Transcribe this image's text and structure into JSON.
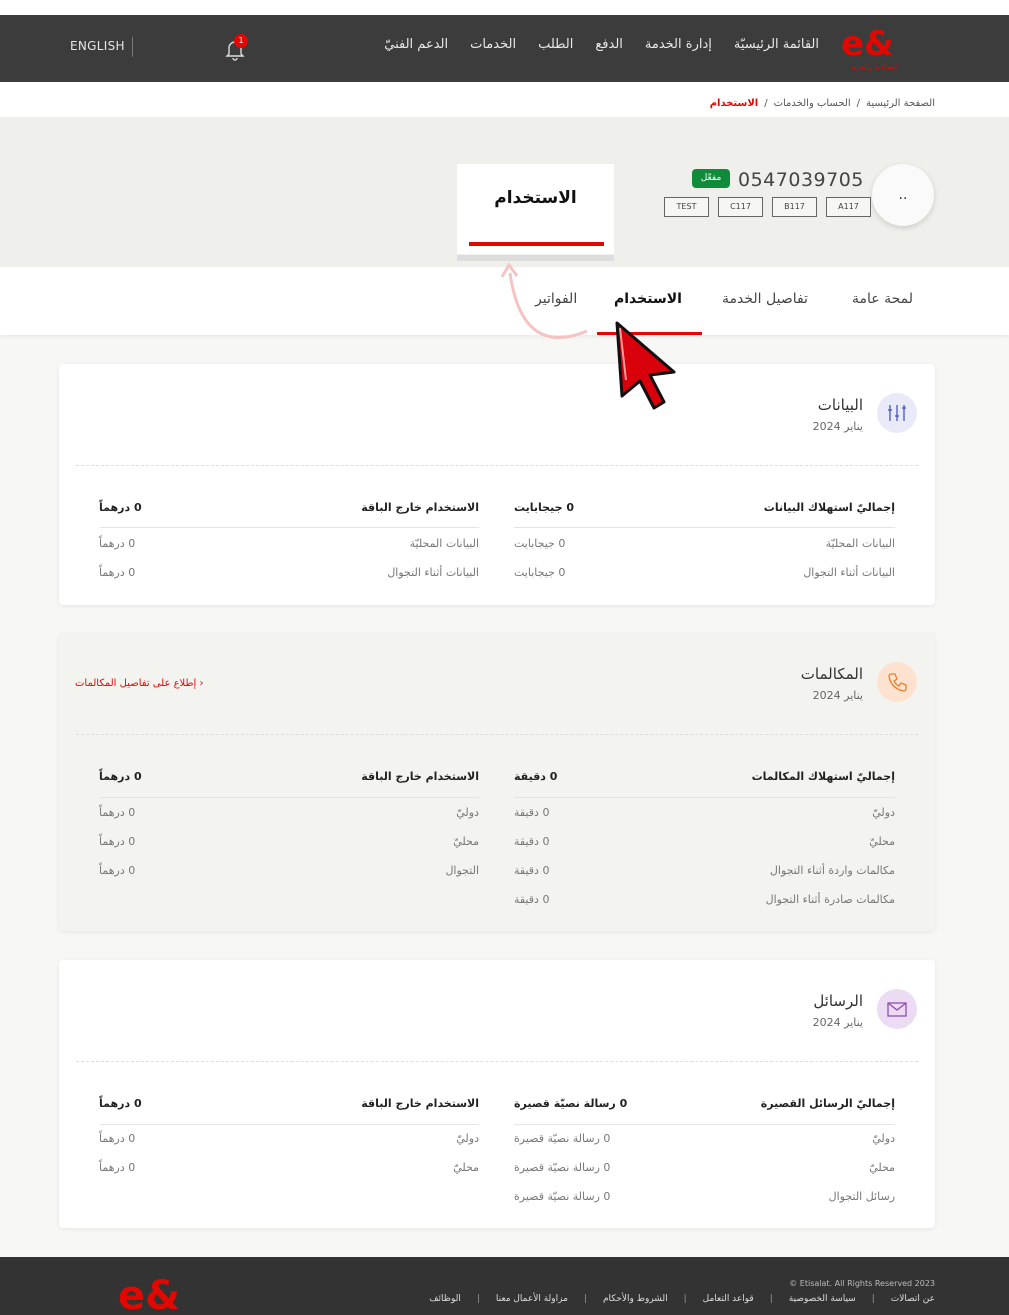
{
  "nav": {
    "language": "ENGLISH",
    "notification_count": "1",
    "menu": [
      "القائمة الرئيسيّة",
      "إدارة الخدمة",
      "الدفع",
      "الطلب",
      "الخدمات",
      "الدعم الفنيّ"
    ],
    "logo_sub": "اتصالات والمزيد"
  },
  "breadcrumb": {
    "home": "الصفحة الرئيسية",
    "section": "الحساب والخدمات",
    "current": "الاستخدام",
    "sep": "/"
  },
  "account": {
    "avatar": "..",
    "number": "0547039705",
    "status": "مفعّل",
    "chips": [
      "A117",
      "B117",
      "C117",
      "TEST"
    ],
    "zoom_title": "الاستخدام"
  },
  "tabs": [
    "لمحة عامة",
    "تفاصيل الخدمة",
    "الاستخدام",
    "الفواتير"
  ],
  "data_card": {
    "title": "البيانات",
    "period": "يناير 2024",
    "left_header": "إجماليّ استهلاك البيانات",
    "left_total": "0 جيجابايت",
    "right_header": "الاستخدام خارج الباقة",
    "right_total": "0 درهماً",
    "left_rows": [
      {
        "label": "البيانات المحليّة",
        "value": "0 جيجابايت"
      },
      {
        "label": "البيانات أثناء التجوال",
        "value": "0 جيجابايت"
      }
    ],
    "right_rows": [
      {
        "label": "البيانات المحليّة",
        "value": "0 درهماً"
      },
      {
        "label": "البيانات أثناء التجوال",
        "value": "0 درهماً"
      }
    ]
  },
  "calls_card": {
    "title": "المكالمات",
    "period": "يناير 2024",
    "link": "إطلاع على تفاصيل المكالمات",
    "left_header": "إجماليّ استهلاك المكالمات",
    "left_total": "0 دقيقة",
    "right_header": "الاستخدام خارج الباقة",
    "right_total": "0 درهماً",
    "left_rows": [
      {
        "label": "دوليّ",
        "value": "0 دقيقة"
      },
      {
        "label": "محليّ",
        "value": "0 دقيقة"
      },
      {
        "label": "مكالمات واردة أثناء التجوال",
        "value": "0 دقيقة"
      },
      {
        "label": "مكالمات صادرة أثناء التجوال",
        "value": "0 دقيقة"
      }
    ],
    "right_rows": [
      {
        "label": "دوليّ",
        "value": "0 درهماً"
      },
      {
        "label": "محليّ",
        "value": "0 درهماً"
      },
      {
        "label": "التجوال",
        "value": "0 درهماً"
      }
    ]
  },
  "sms_card": {
    "title": "الرسائل",
    "period": "يناير 2024",
    "left_header": "إجماليّ الرسائل القصيرة",
    "left_total": "0 رسالة نصيّة قصيرة",
    "right_header": "الاستخدام خارج الباقة",
    "right_total": "0 درهماً",
    "left_rows": [
      {
        "label": "دوليّ",
        "value": "0 رسالة نصيّة قصيرة"
      },
      {
        "label": "محليّ",
        "value": "0 رسالة نصيّة قصيرة"
      },
      {
        "label": "رسائل التجوال",
        "value": "0 رسالة نصيّة قصيرة"
      }
    ],
    "right_rows": [
      {
        "label": "دوليّ",
        "value": "0 درهماً"
      },
      {
        "label": "محليّ",
        "value": "0 درهماً"
      }
    ]
  },
  "footer": {
    "copyright": "2023 Etisalat. All Rights Reserved ©",
    "links": [
      "عن اتصالات",
      "سياسة الخصوصية",
      "قواعد التعامل",
      "الشروط والأحكام",
      "مزاولة الأعمال معنا",
      "الوظائف"
    ]
  },
  "colors": {
    "brand_red": "#e00800",
    "nav_bg": "#3c3c3c",
    "active_green": "#0f8b3a"
  }
}
